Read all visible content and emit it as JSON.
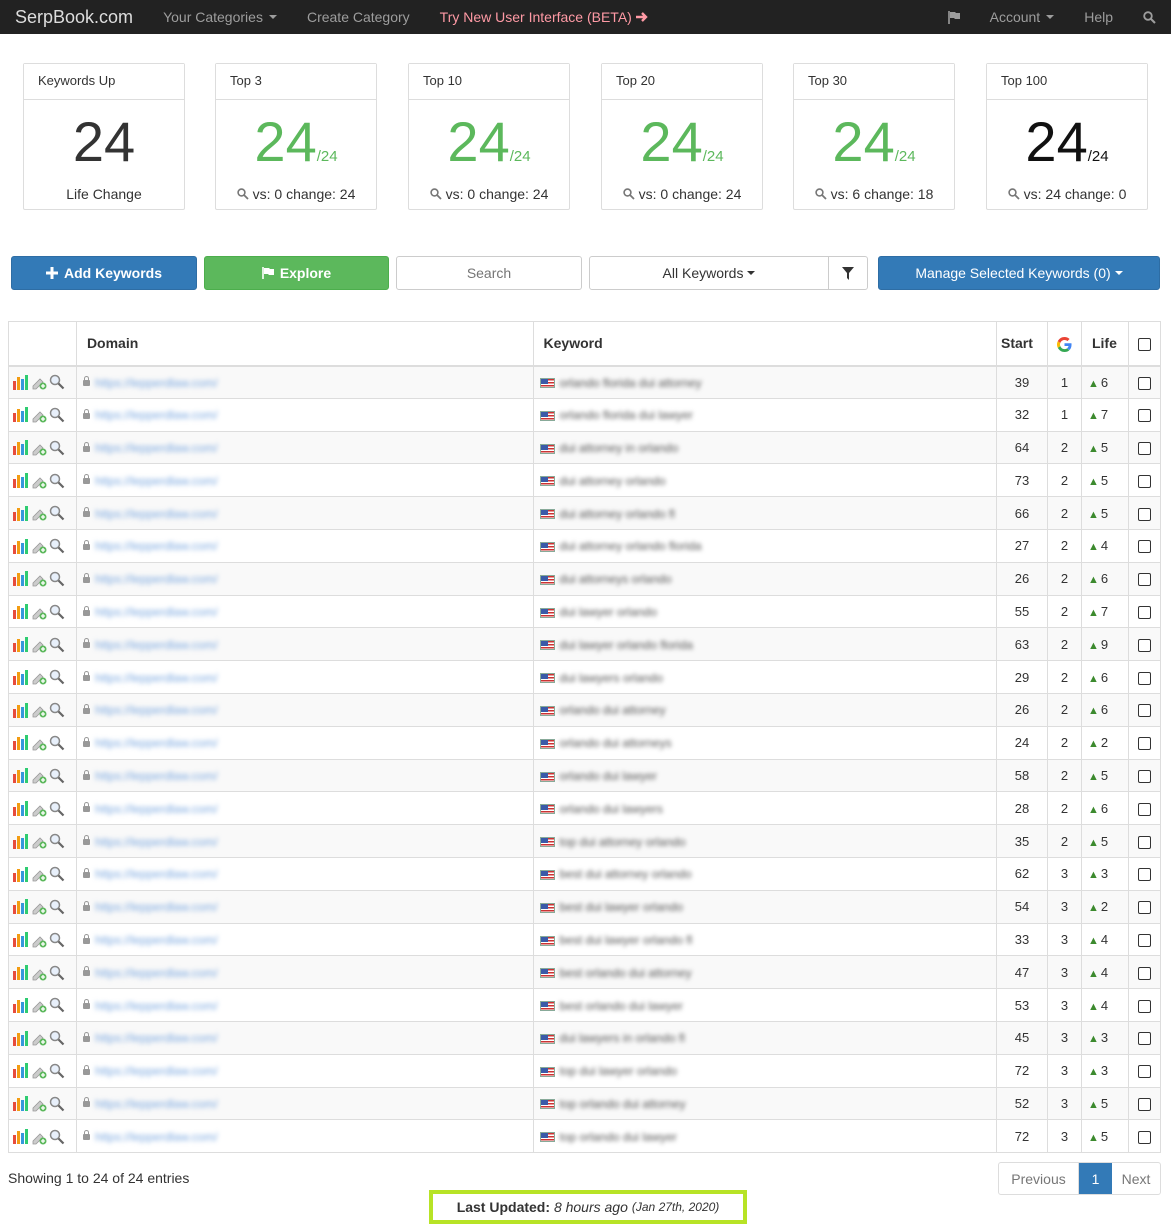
{
  "nav": {
    "brand": "SerpBook.com",
    "categories": "Your Categories",
    "create": "Create Category",
    "beta": "Try New User Interface (BETA)",
    "account": "Account",
    "help": "Help"
  },
  "cards": [
    {
      "title": "Keywords Up",
      "value": "24",
      "of": "",
      "footer": "Life Change",
      "color": "#333333"
    },
    {
      "title": "Top 3",
      "value": "24",
      "of": "/24",
      "footer": "vs: 0 change: 24",
      "color": "#5cb85c"
    },
    {
      "title": "Top 10",
      "value": "24",
      "of": "/24",
      "footer": "vs: 0 change: 24",
      "color": "#5cb85c"
    },
    {
      "title": "Top 20",
      "value": "24",
      "of": "/24",
      "footer": "vs: 0 change: 24",
      "color": "#5cb85c"
    },
    {
      "title": "Top 30",
      "value": "24",
      "of": "/24",
      "footer": "vs: 6 change: 18",
      "color": "#5cb85c"
    },
    {
      "title": "Top 100",
      "value": "24",
      "of": "/24",
      "footer": "vs: 24 change: 0",
      "color": "#111111"
    }
  ],
  "toolbar": {
    "add": "Add Keywords",
    "explore": "Explore",
    "search_placeholder": "Search",
    "filter": "All Keywords",
    "manage": "Manage Selected Keywords (0)"
  },
  "table": {
    "headers": {
      "domain": "Domain",
      "keyword": "Keyword",
      "start": "Start",
      "life": "Life"
    },
    "rows": [
      {
        "domain": "https://lepperdlaw.com/",
        "keyword": "orlando florida dui attorney",
        "start": "39",
        "g": "1",
        "life": "6"
      },
      {
        "domain": "https://lepperdlaw.com/",
        "keyword": "orlando florida dui lawyer",
        "start": "32",
        "g": "1",
        "life": "7"
      },
      {
        "domain": "https://lepperdlaw.com/",
        "keyword": "dui attorney in orlando",
        "start": "64",
        "g": "2",
        "life": "5"
      },
      {
        "domain": "https://lepperdlaw.com/",
        "keyword": "dui attorney orlando",
        "start": "73",
        "g": "2",
        "life": "5"
      },
      {
        "domain": "https://lepperdlaw.com/",
        "keyword": "dui attorney orlando fl",
        "start": "66",
        "g": "2",
        "life": "5"
      },
      {
        "domain": "https://lepperdlaw.com/",
        "keyword": "dui attorney orlando florida",
        "start": "27",
        "g": "2",
        "life": "4"
      },
      {
        "domain": "https://lepperdlaw.com/",
        "keyword": "dui attorneys orlando",
        "start": "26",
        "g": "2",
        "life": "6"
      },
      {
        "domain": "https://lepperdlaw.com/",
        "keyword": "dui lawyer orlando",
        "start": "55",
        "g": "2",
        "life": "7"
      },
      {
        "domain": "https://lepperdlaw.com/",
        "keyword": "dui lawyer orlando florida",
        "start": "63",
        "g": "2",
        "life": "9"
      },
      {
        "domain": "https://lepperdlaw.com/",
        "keyword": "dui lawyers orlando",
        "start": "29",
        "g": "2",
        "life": "6"
      },
      {
        "domain": "https://lepperdlaw.com/",
        "keyword": "orlando dui attorney",
        "start": "26",
        "g": "2",
        "life": "6"
      },
      {
        "domain": "https://lepperdlaw.com/",
        "keyword": "orlando dui attorneys",
        "start": "24",
        "g": "2",
        "life": "2"
      },
      {
        "domain": "https://lepperdlaw.com/",
        "keyword": "orlando dui lawyer",
        "start": "58",
        "g": "2",
        "life": "5"
      },
      {
        "domain": "https://lepperdlaw.com/",
        "keyword": "orlando dui lawyers",
        "start": "28",
        "g": "2",
        "life": "6"
      },
      {
        "domain": "https://lepperdlaw.com/",
        "keyword": "top dui attorney orlando",
        "start": "35",
        "g": "2",
        "life": "5"
      },
      {
        "domain": "https://lepperdlaw.com/",
        "keyword": "best dui attorney orlando",
        "start": "62",
        "g": "3",
        "life": "3"
      },
      {
        "domain": "https://lepperdlaw.com/",
        "keyword": "best dui lawyer orlando",
        "start": "54",
        "g": "3",
        "life": "2"
      },
      {
        "domain": "https://lepperdlaw.com/",
        "keyword": "best dui lawyer orlando fl",
        "start": "33",
        "g": "3",
        "life": "4"
      },
      {
        "domain": "https://lepperdlaw.com/",
        "keyword": "best orlando dui attorney",
        "start": "47",
        "g": "3",
        "life": "4"
      },
      {
        "domain": "https://lepperdlaw.com/",
        "keyword": "best orlando dui lawyer",
        "start": "53",
        "g": "3",
        "life": "4"
      },
      {
        "domain": "https://lepperdlaw.com/",
        "keyword": "dui lawyers in orlando fl",
        "start": "45",
        "g": "3",
        "life": "3"
      },
      {
        "domain": "https://lepperdlaw.com/",
        "keyword": "top dui lawyer orlando",
        "start": "72",
        "g": "3",
        "life": "3"
      },
      {
        "domain": "https://lepperdlaw.com/",
        "keyword": "top orlando dui attorney",
        "start": "52",
        "g": "3",
        "life": "5"
      },
      {
        "domain": "https://lepperdlaw.com/",
        "keyword": "top orlando dui lawyer",
        "start": "72",
        "g": "3",
        "life": "5"
      }
    ]
  },
  "footer": {
    "showing": "Showing 1 to 24 of 24 entries",
    "prev": "Previous",
    "page": "1",
    "next": "Next",
    "last_label": "Last Updated",
    "last_ago": "8 hours ago",
    "last_date": "(Jan 27th, 2020)"
  },
  "icons": [
    "caret-down-icon",
    "arrow-right-icon",
    "flag-icon",
    "search-icon",
    "plus-icon",
    "filter-icon",
    "bar-chart-icon",
    "add-note-icon",
    "magnifier-icon",
    "lock-icon",
    "us-flag-icon",
    "google-icon",
    "arrow-up-icon",
    "checkbox-icon"
  ]
}
